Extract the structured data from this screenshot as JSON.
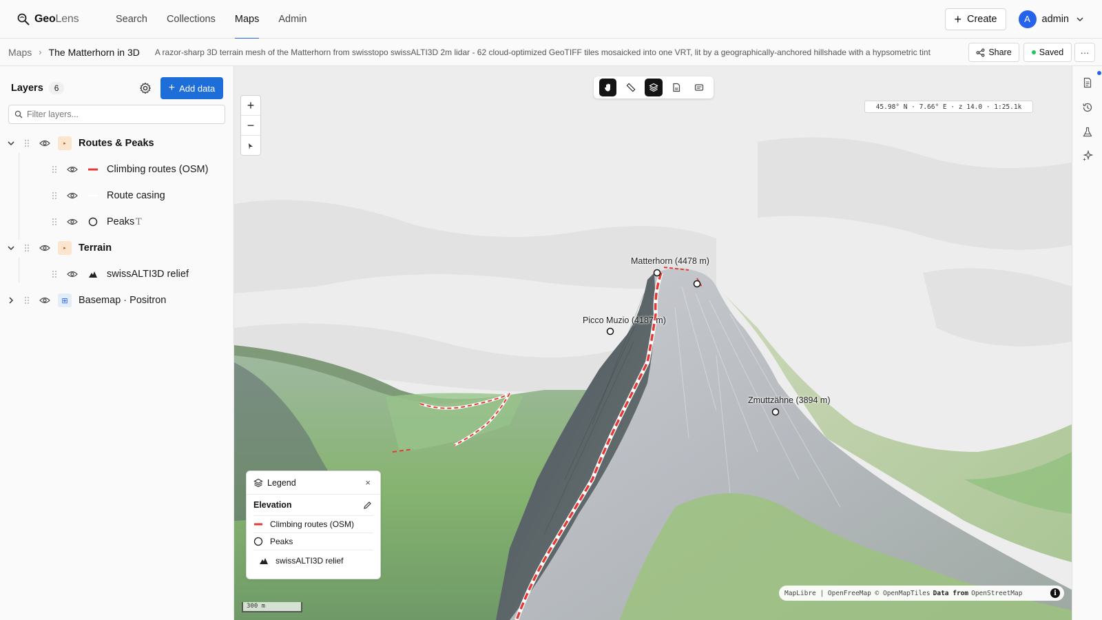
{
  "app": {
    "brand_bold": "Geo",
    "brand_light": "Lens"
  },
  "nav": {
    "items": [
      {
        "label": "Search"
      },
      {
        "label": "Collections"
      },
      {
        "label": "Maps"
      },
      {
        "label": "Admin"
      }
    ],
    "active": "Maps"
  },
  "header": {
    "create_label": "Create",
    "avatar_initial": "A",
    "user_name": "admin"
  },
  "breadcrumb": {
    "root": "Maps",
    "title": "The Matterhorn in 3D",
    "description": "A razor-sharp 3D terrain mesh of the Matterhorn from swisstopo swissALTI3D 2m lidar - 62 cloud-optimized GeoTIFF tiles mosaicked into one VRT, lit by a geographically-anchored hillshade with a hypsometric tint",
    "share_label": "Share",
    "saved_label": "Saved",
    "more_label": "···"
  },
  "sidebar": {
    "title": "Layers",
    "count": "6",
    "add_label": "Add data",
    "filter_placeholder": "Filter layers...",
    "layers": [
      {
        "name": "Routes & Peaks",
        "kind": "group",
        "expanded": true
      },
      {
        "name": "Climbing routes (OSM)",
        "kind": "line"
      },
      {
        "name": "Route casing",
        "kind": "line-white"
      },
      {
        "name": "Peaks",
        "kind": "circle",
        "has_labels": true
      },
      {
        "name": "Terrain",
        "kind": "group",
        "expanded": true
      },
      {
        "name": "swissALTI3D relief",
        "kind": "terrain"
      },
      {
        "name": "Basemap · Positron",
        "kind": "basemap",
        "expanded": false
      }
    ]
  },
  "map": {
    "coords": "45.98° N · 7.66° E · z 14.0 · 1:25.1k",
    "peaks": [
      {
        "label": "Matterhorn (4478 m)"
      },
      {
        "label": "Picco Muzio (4187 m)"
      },
      {
        "label": "Zmuttzähne (3894 m)"
      }
    ],
    "scale": "300 m",
    "attribution": {
      "a": "MapLibre | OpenFreeMap © OpenMapTiles",
      "b": "Data from",
      "c": "OpenStreetMap"
    },
    "route_color": "#e53935"
  },
  "legend": {
    "title": "Legend",
    "close": "×",
    "section": "Elevation",
    "items": [
      {
        "label": "Climbing routes (OSM)"
      },
      {
        "label": "Peaks"
      },
      {
        "label": "swissALTI3D relief"
      }
    ]
  },
  "colors": {
    "accent": "#2563eb",
    "primary_button": "#1d6ed8",
    "saved": "#22c55e"
  }
}
